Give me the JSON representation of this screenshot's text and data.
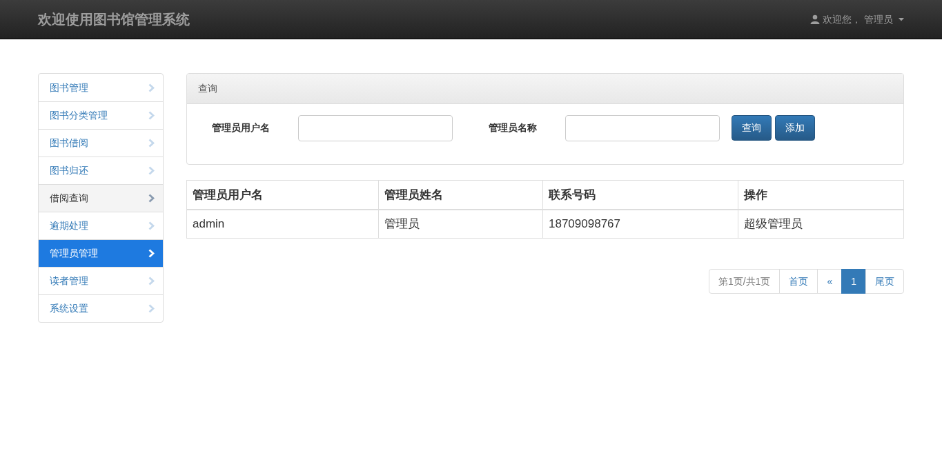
{
  "navbar": {
    "brand": "欢迎使用图书馆管理系统",
    "user_menu": "欢迎您， 管理员"
  },
  "sidebar": {
    "items": [
      {
        "label": "图书管理",
        "selected": false,
        "hovered": false
      },
      {
        "label": "图书分类管理",
        "selected": false,
        "hovered": false
      },
      {
        "label": "图书借阅",
        "selected": false,
        "hovered": false
      },
      {
        "label": "图书归还",
        "selected": false,
        "hovered": false
      },
      {
        "label": "借阅查询",
        "selected": false,
        "hovered": true
      },
      {
        "label": "逾期处理",
        "selected": false,
        "hovered": false
      },
      {
        "label": "管理员管理",
        "selected": true,
        "hovered": false
      },
      {
        "label": "读者管理",
        "selected": false,
        "hovered": false
      },
      {
        "label": "系统设置",
        "selected": false,
        "hovered": false
      }
    ]
  },
  "query_panel": {
    "title": "查询",
    "fields": [
      {
        "label": "管理员用户名"
      },
      {
        "label": "管理员名称"
      }
    ],
    "buttons": [
      "查询",
      "添加"
    ]
  },
  "table": {
    "columns": [
      "管理员用户名",
      "管理员姓名",
      "联系号码",
      "操作"
    ],
    "rows": [
      [
        "admin",
        "管理员",
        "18709098767",
        "超级管理员"
      ]
    ]
  },
  "pagination": [
    {
      "kind": "info",
      "label": "第1页/共1页",
      "selected": false
    },
    {
      "kind": "link",
      "label": "首页",
      "selected": false
    },
    {
      "kind": "link",
      "label": "«",
      "selected": false
    },
    {
      "kind": "link",
      "label": "1",
      "selected": true
    },
    {
      "kind": "link",
      "label": "尾页",
      "selected": false
    }
  ]
}
